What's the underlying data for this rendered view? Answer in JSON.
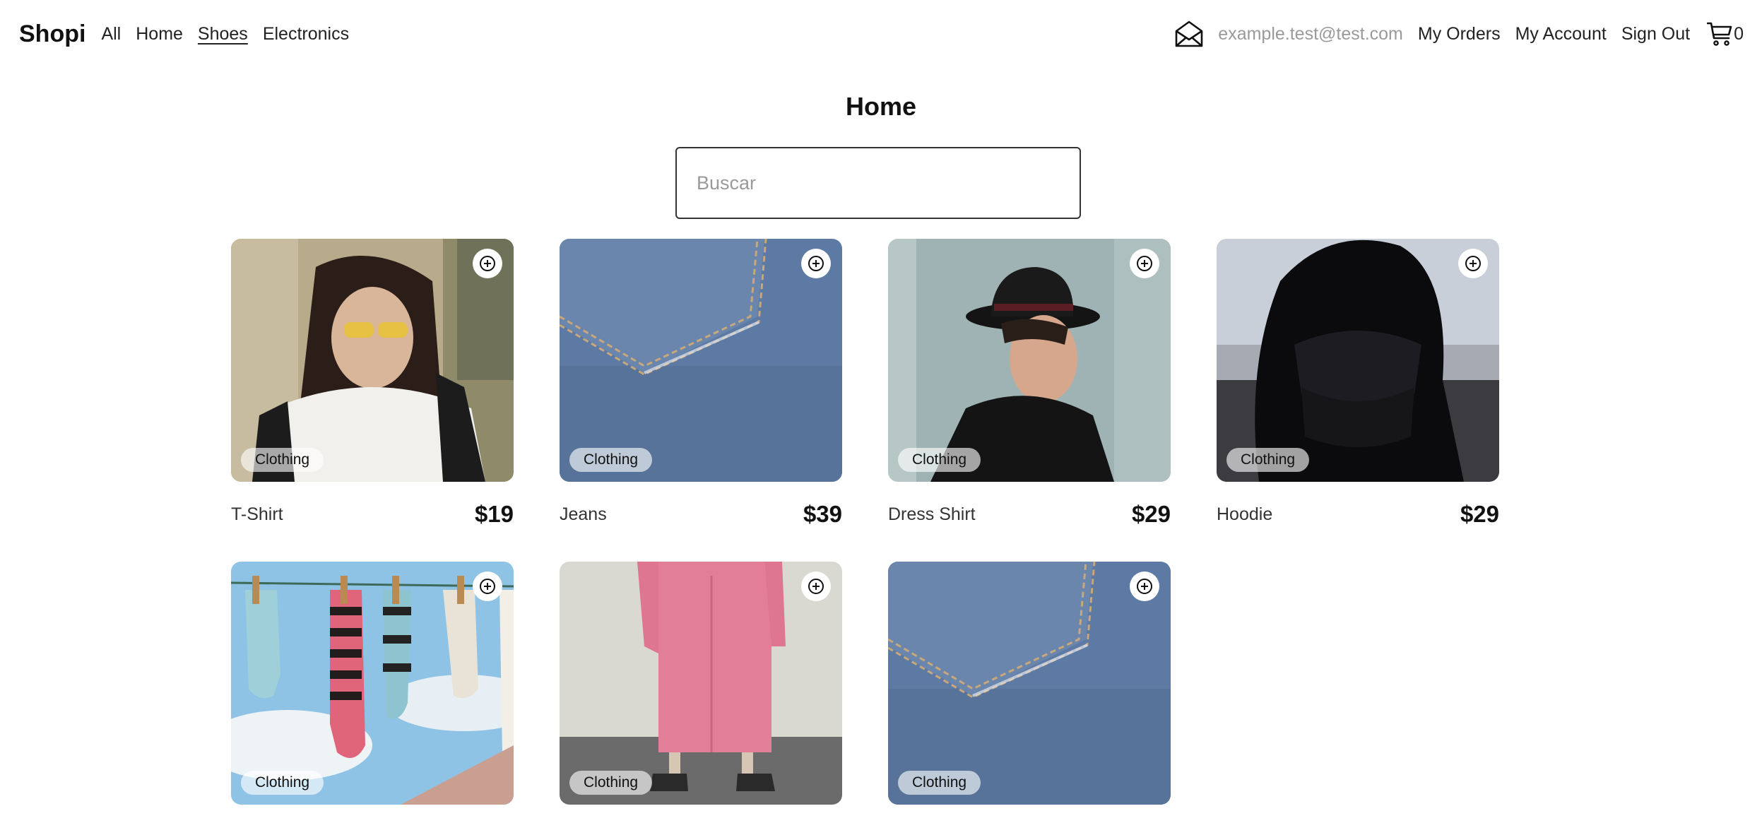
{
  "nav": {
    "brand": "Shopi",
    "links": [
      "All",
      "Home",
      "Shoes",
      "Electronics"
    ],
    "active_link": "Shoes",
    "email": "example.test@test.com",
    "my_orders": "My Orders",
    "my_account": "My Account",
    "sign_out": "Sign Out",
    "cart_count": "0",
    "icons": {
      "mail": "mail-icon",
      "cart": "cart-icon"
    }
  },
  "main": {
    "title": "Home",
    "search": {
      "placeholder": "Buscar",
      "value": ""
    }
  },
  "products": [
    {
      "name": "T-Shirt",
      "price": "$19",
      "category": "Clothing",
      "image": "woman-yellow-sunglasses"
    },
    {
      "name": "Jeans",
      "price": "$39",
      "category": "Clothing",
      "image": "denim-pocket"
    },
    {
      "name": "Dress Shirt",
      "price": "$29",
      "category": "Clothing",
      "image": "man-black-hat"
    },
    {
      "name": "Hoodie",
      "price": "$29",
      "category": "Clothing",
      "image": "black-hoodie-cap"
    },
    {
      "name": "",
      "price": "",
      "category": "Clothing",
      "image": "socks-clothesline"
    },
    {
      "name": "",
      "price": "",
      "category": "Clothing",
      "image": "pink-coat"
    },
    {
      "name": "",
      "price": "",
      "category": "Clothing",
      "image": "denim-pocket"
    }
  ]
}
